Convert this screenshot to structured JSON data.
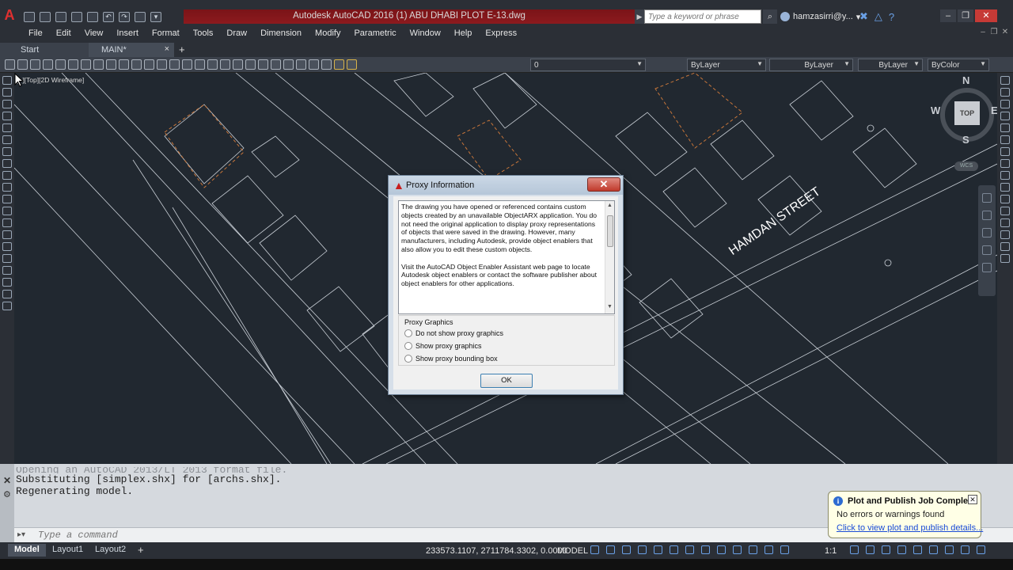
{
  "window": {
    "title": "Autodesk AutoCAD 2016    (1) ABU DHABI PLOT E-13.dwg",
    "app_icon": "autocad-logo",
    "search_placeholder": "Type a keyword or phrase",
    "user": "hamzasirri@y...",
    "user_caret": "▾"
  },
  "menu": {
    "items": [
      "File",
      "Edit",
      "View",
      "Insert",
      "Format",
      "Tools",
      "Draw",
      "Dimension",
      "Modify",
      "Parametric",
      "Window",
      "Help",
      "Express"
    ]
  },
  "file_tabs": {
    "start": "Start",
    "main": "MAIN*",
    "close_glyph": "×",
    "add_glyph": "+"
  },
  "toolbar": {
    "layer": "0",
    "color": "ByLayer",
    "linetype": "ByLayer",
    "lineweight": "ByLayer",
    "plotstyle": "ByColor"
  },
  "drawing": {
    "viewport_label": "[−][Top][2D Wireframe]",
    "street_label": "HAMDAN STREET",
    "background": "#212830",
    "line_color": "#c9cfd6",
    "plot_boundary_color": "#c8763a"
  },
  "viewcube": {
    "north": "N",
    "south": "S",
    "east": "E",
    "west": "W",
    "face": "TOP",
    "wcs": "WCS"
  },
  "dialog": {
    "title": "Proxy Information",
    "close_glyph": "✕",
    "paragraph_1": "The drawing you have opened or referenced contains custom objects created by an unavailable ObjectARX application. You do not need the original application to display proxy representations of objects that were saved in the drawing. However, many manufacturers, including Autodesk, provide object enablers that also allow you to edit these custom objects.",
    "paragraph_2": "Visit the AutoCAD Object Enabler Assistant web page to locate Autodesk object enablers or contact the software publisher about object enablers for other applications.",
    "group_label": "Proxy Graphics",
    "options": [
      "Do not show proxy graphics",
      "Show proxy graphics",
      "Show proxy bounding box"
    ],
    "ok_label": "OK"
  },
  "command": {
    "history_faded": "Opening an AutoCAD 2013/LT 2013 format file.",
    "history": [
      "Substituting [simplex.shx] for [archs.shx].",
      "Regenerating model."
    ],
    "placeholder": "Type a command"
  },
  "status": {
    "layouts": [
      "Model",
      "Layout1",
      "Layout2"
    ],
    "add_layout": "+",
    "coordinates": "233573.1107, 2711784.3302, 0.0000",
    "space": "MODEL",
    "annotation_scale": "1:1",
    "accent": "#6aa0e6"
  },
  "notification": {
    "title": "Plot and Publish Job Complete",
    "message": "No errors or warnings found",
    "link": "Click to view plot and publish details...",
    "close_glyph": "✕"
  }
}
